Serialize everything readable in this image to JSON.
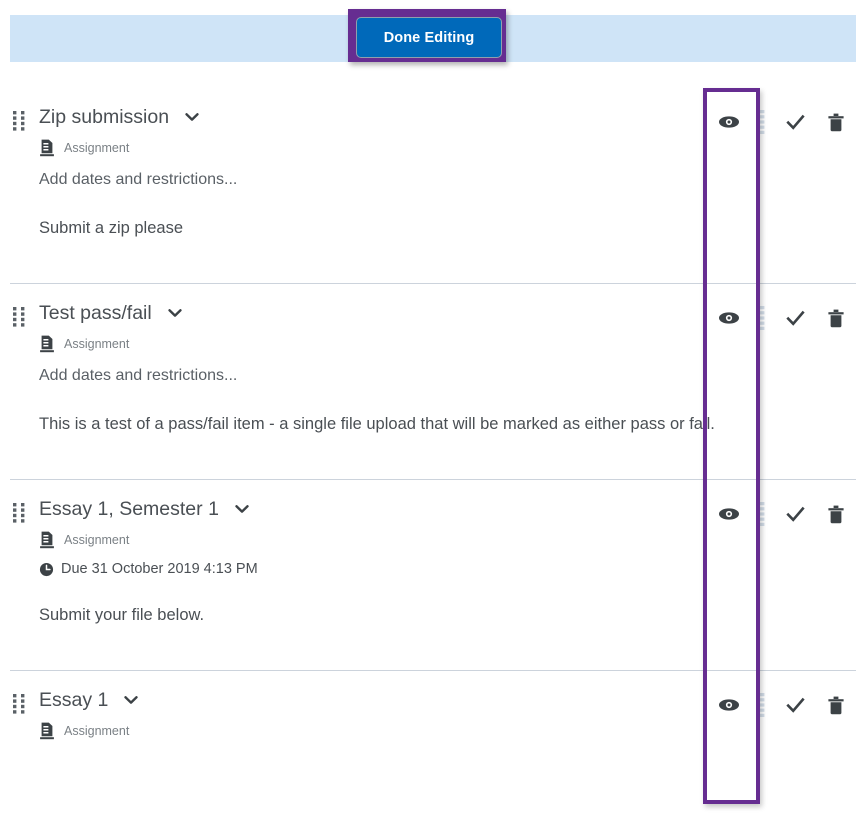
{
  "action_bar": {
    "done_editing_label": "Done Editing",
    "bar_color": "#cfe4f7",
    "button_color": "#0069ba",
    "highlight_color": "#662d91"
  },
  "icons": {
    "drag_handle": "drag-handle-icon",
    "chevron_down": "chevron-down-icon",
    "assignment": "assignment-document-icon",
    "clock": "clock-icon",
    "eye": "eye-icon",
    "check": "check-icon",
    "vertical_dots": "vertical-dots-drag-icon",
    "trash": "trash-icon"
  },
  "items": [
    {
      "title": "Zip submission",
      "type_label": "Assignment",
      "sub_text": "Add dates and restrictions...",
      "description": "Submit a zip please",
      "due": null
    },
    {
      "title": "Test pass/fail",
      "type_label": "Assignment",
      "sub_text": "Add dates and restrictions...",
      "description": "This is a test of a pass/fail item - a single file upload that will be marked as either pass or fail.",
      "due": null
    },
    {
      "title": "Essay 1, Semester 1",
      "type_label": "Assignment",
      "sub_text": null,
      "description": "Submit your file below.",
      "due": "Due 31 October 2019 4:13 PM"
    },
    {
      "title": "Essay 1",
      "type_label": "Assignment",
      "sub_text": null,
      "description": null,
      "due": null
    }
  ]
}
